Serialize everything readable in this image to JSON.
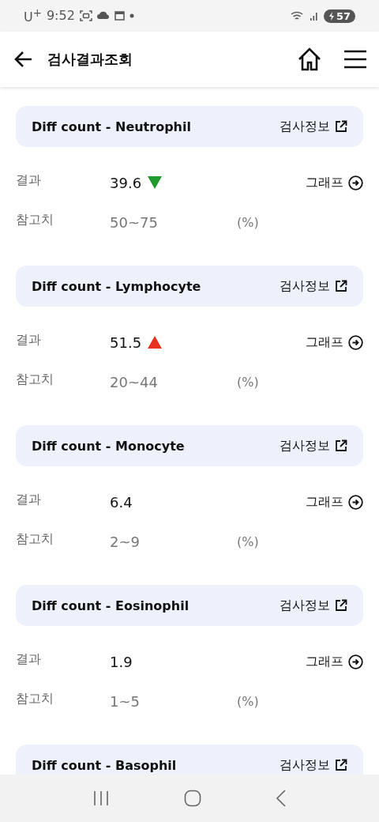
{
  "status_bar": {
    "carrier": "U$^{+}$",
    "time": "9:52",
    "battery": "57"
  },
  "header": {
    "title": "검사결과조회"
  },
  "tests": [
    {
      "name": "Diff count - Neutrophil",
      "info_link": "검사정보",
      "result_label": "결과",
      "value": "39.6",
      "below_range": true,
      "above_range": false,
      "graph_link": "그래프",
      "ref_label": "참고치",
      "ref_range": "50~75",
      "unit": "(%)"
    },
    {
      "name": "Diff count - Lymphocyte",
      "info_link": "검사정보",
      "result_label": "결과",
      "value": "51.5",
      "below_range": false,
      "above_range": true,
      "graph_link": "그래프",
      "ref_label": "참고치",
      "ref_range": "20~44",
      "unit": "(%)"
    },
    {
      "name": "Diff count - Monocyte",
      "info_link": "검사정보",
      "result_label": "결과",
      "value": "6.4",
      "below_range": false,
      "above_range": false,
      "graph_link": "그래프",
      "ref_label": "참고치",
      "ref_range": "2~9",
      "unit": "(%)"
    },
    {
      "name": "Diff count - Eosinophil",
      "info_link": "검사정보",
      "result_label": "결과",
      "value": "1.9",
      "below_range": false,
      "above_range": false,
      "graph_link": "그래프",
      "ref_label": "참고치",
      "ref_range": "1~5",
      "unit": "(%)"
    },
    {
      "name": "Diff count - Basophil",
      "info_link": "검사정보"
    }
  ]
}
